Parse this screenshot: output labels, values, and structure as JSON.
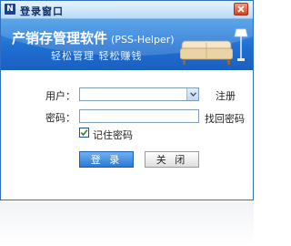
{
  "window": {
    "title": "登录窗口",
    "app_icon_letter": "N",
    "close_icon": "close-icon"
  },
  "banner": {
    "title": "产销存管理软件",
    "subtitle": "(PSS-Helper)",
    "slogan": "轻松管理  轻松赚钱",
    "icons": [
      "sofa-icon",
      "lamp-icon"
    ]
  },
  "form": {
    "username_label": "用户：",
    "username_value": "",
    "register_link": "注册",
    "password_label": "密码：",
    "password_value": "",
    "forgot_link": "找回密码",
    "remember_label": "记住密码",
    "remember_checked": true
  },
  "buttons": {
    "login": "登 录",
    "close": "关 闭"
  },
  "colors": {
    "banner": "#1f6fd3",
    "border": "#2f6fbe"
  }
}
